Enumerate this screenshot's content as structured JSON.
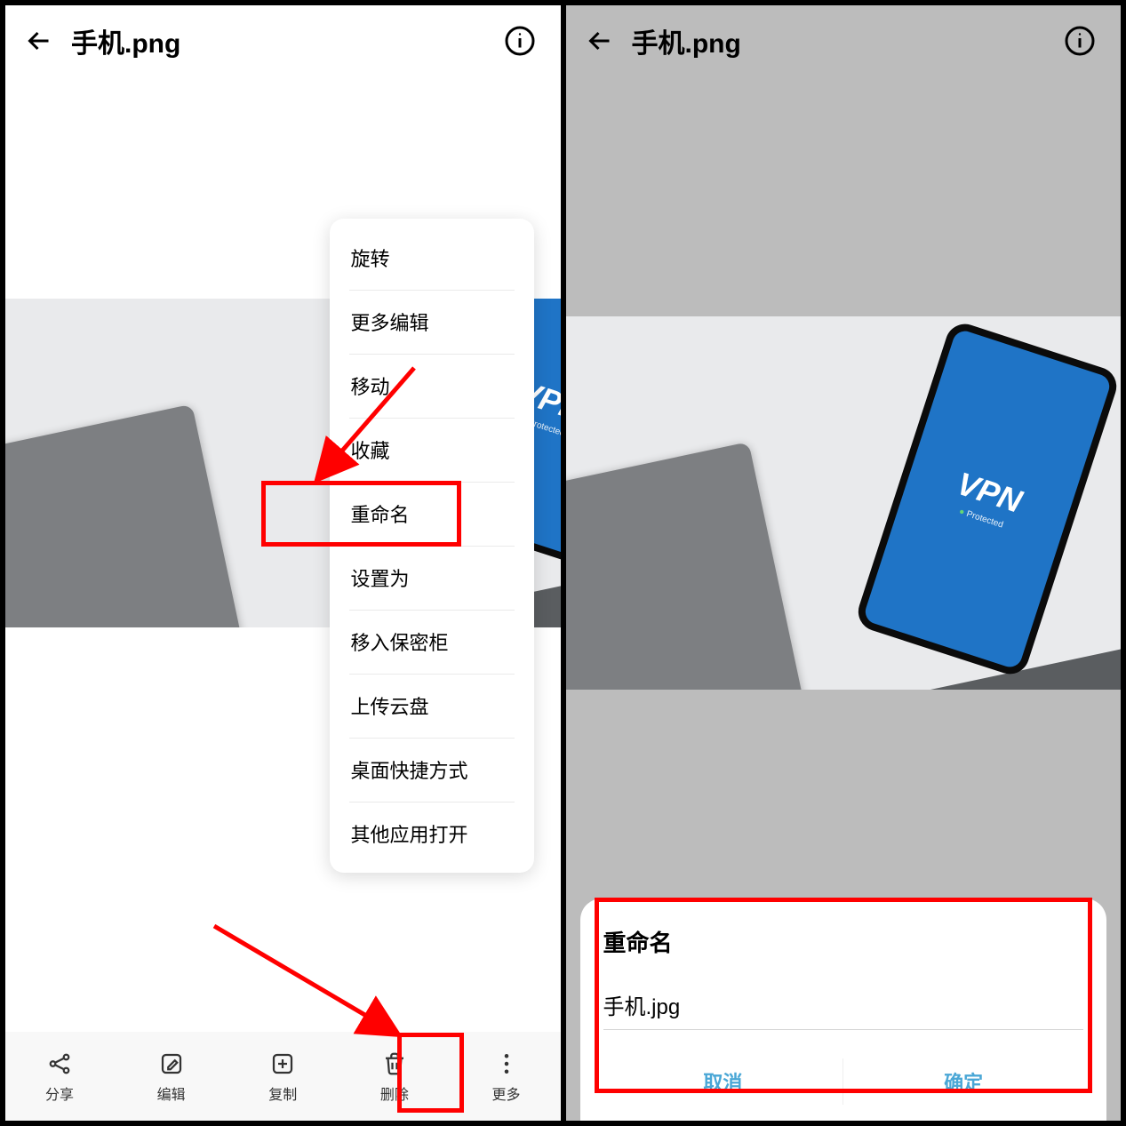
{
  "left": {
    "header_title": "手机.png",
    "menu": {
      "items": [
        "旋转",
        "更多编辑",
        "移动",
        "收藏",
        "重命名",
        "设置为",
        "移入保密柜",
        "上传云盘",
        "桌面快捷方式",
        "其他应用打开"
      ]
    },
    "toolbar": {
      "share": "分享",
      "edit": "编辑",
      "copy": "复制",
      "delete": "删除",
      "more": "更多"
    },
    "photo": {
      "phone_text": "VPN",
      "phone_sub": "Protected"
    }
  },
  "right": {
    "header_title": "手机.png",
    "photo": {
      "phone_text": "VPN",
      "phone_sub": "Protected"
    },
    "dialog": {
      "title": "重命名",
      "input_value": "手机.jpg",
      "cancel": "取消",
      "confirm": "确定"
    }
  }
}
